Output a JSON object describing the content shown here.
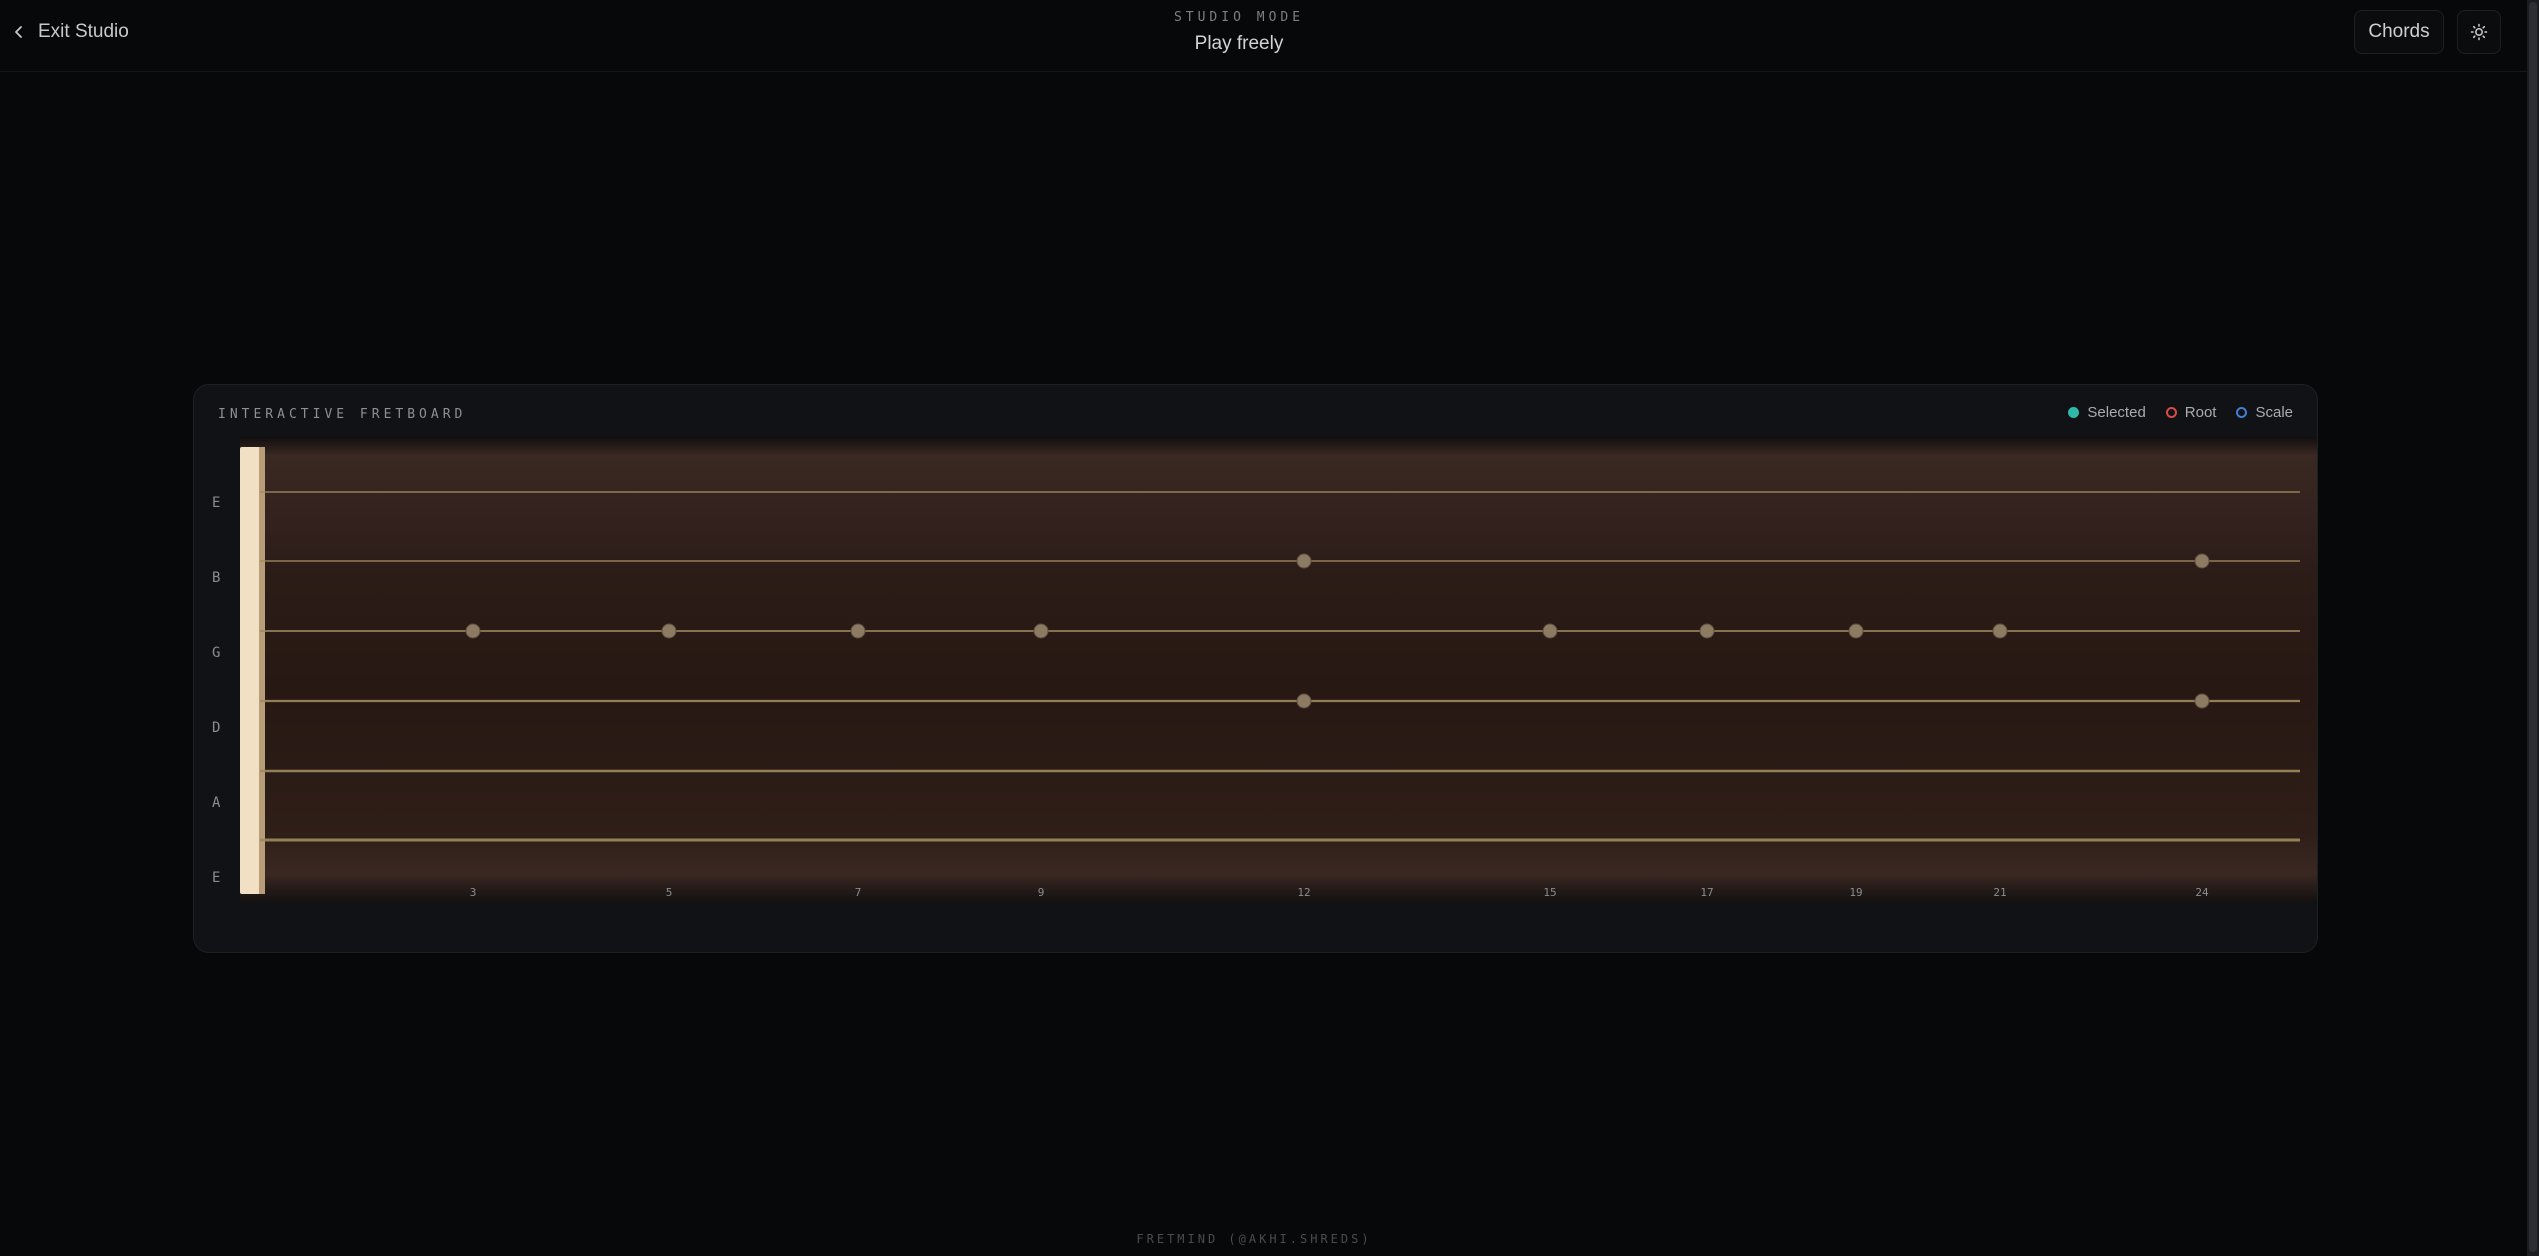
{
  "header": {
    "exit_label": "Exit Studio",
    "mode_kicker": "STUDIO MODE",
    "mode_title": "Play freely",
    "chords_label": "Chords",
    "theme_icon": "sun-icon"
  },
  "fretboard": {
    "title": "INTERACTIVE FRETBOARD",
    "legend": [
      {
        "label": "Selected",
        "color": "#2fb8a8"
      },
      {
        "label": "Root",
        "color": "#d94a4a"
      },
      {
        "label": "Scale",
        "color": "#3f7fd6"
      }
    ],
    "strings": [
      "E",
      "B",
      "G",
      "D",
      "A",
      "E"
    ],
    "total_frets": 24,
    "marker_frets": [
      3,
      5,
      7,
      9,
      12,
      15,
      17,
      19,
      21,
      24
    ],
    "double_marker_frets": [
      12,
      24
    ],
    "colors": {
      "marker": "#8c7a62",
      "string": "#a08a5e",
      "nut": "#f1e0c4"
    }
  },
  "footer": {
    "credit": "FRETMIND (@AKHI.SHREDS)"
  }
}
